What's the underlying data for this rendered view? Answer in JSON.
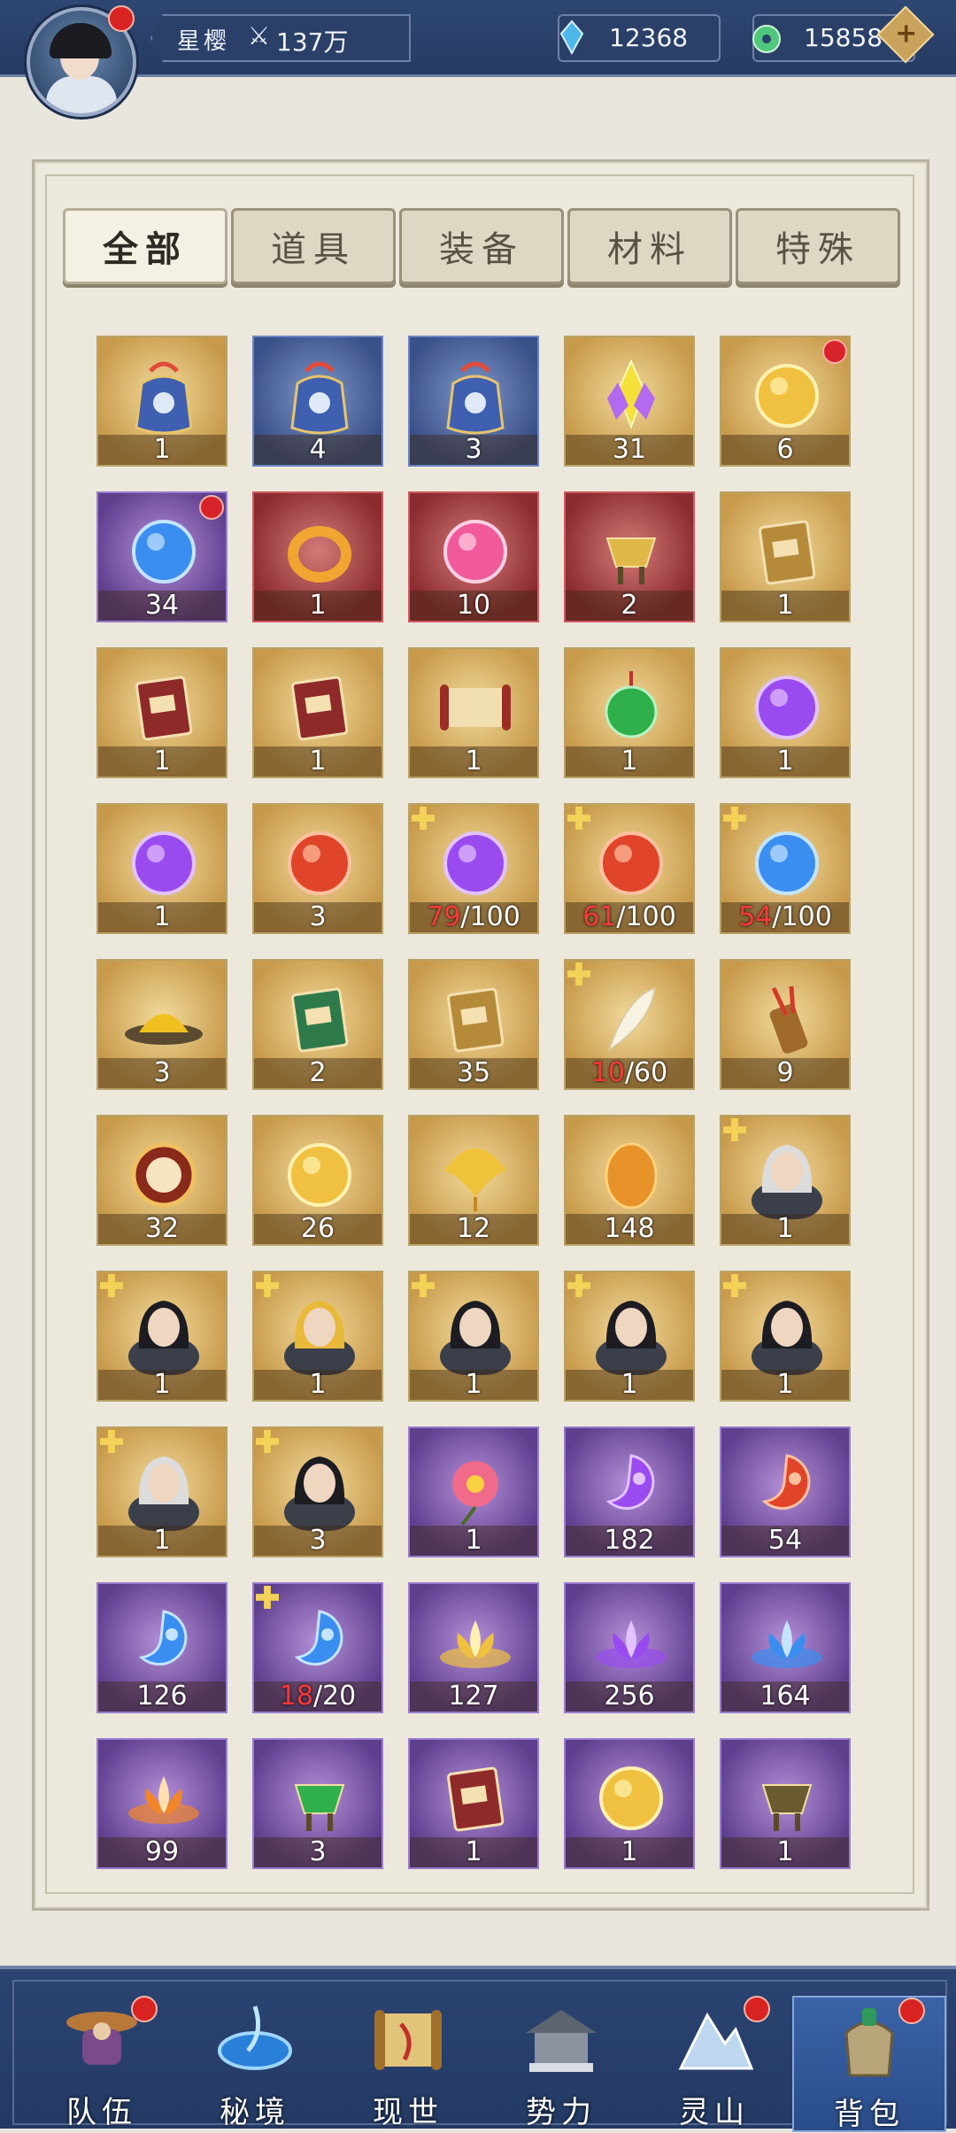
{
  "header": {
    "player_name": "星樱",
    "power": "137万",
    "currency_crystal": "12368",
    "currency_jade": "15858",
    "add_label": "+"
  },
  "tabs": [
    "全部",
    "道具",
    "装备",
    "材料",
    "特殊"
  ],
  "active_tab": "全部",
  "items": [
    {
      "name": "pouch-icon",
      "bg": "gold",
      "count": "1"
    },
    {
      "name": "pouch-icon",
      "bg": "blue",
      "count": "4"
    },
    {
      "name": "pouch-icon",
      "bg": "blue",
      "count": "3"
    },
    {
      "name": "crystal-flower-icon",
      "bg": "gold",
      "count": "31"
    },
    {
      "name": "koi-orb-icon",
      "bg": "gold",
      "count": "6",
      "dot": true
    },
    {
      "name": "blue-koi-orb-icon",
      "bg": "purple",
      "count": "34",
      "dot": true
    },
    {
      "name": "gold-ring-icon",
      "bg": "red",
      "count": "1"
    },
    {
      "name": "pink-orb-icon",
      "bg": "red",
      "count": "10"
    },
    {
      "name": "gold-bowl-icon",
      "bg": "red",
      "count": "2"
    },
    {
      "name": "gold-box-icon",
      "bg": "gold",
      "count": "1"
    },
    {
      "name": "red-book-icon",
      "bg": "gold",
      "count": "1"
    },
    {
      "name": "red-book-icon",
      "bg": "gold",
      "count": "1"
    },
    {
      "name": "scroll-icon",
      "bg": "gold",
      "count": "1"
    },
    {
      "name": "jade-pendant-icon",
      "bg": "gold",
      "count": "1"
    },
    {
      "name": "purple-vase-icon",
      "bg": "gold",
      "count": "1"
    },
    {
      "name": "purple-dragon-orb-icon",
      "bg": "gold",
      "count": "1"
    },
    {
      "name": "red-dragon-orb-icon",
      "bg": "gold",
      "count": "3"
    },
    {
      "name": "purple-dragon-orb-icon",
      "bg": "gold",
      "count": "/100",
      "cur": "79",
      "badge": true
    },
    {
      "name": "red-dragon-orb-icon",
      "bg": "gold",
      "count": "/100",
      "cur": "61",
      "badge": true
    },
    {
      "name": "blue-dragon-orb-icon",
      "bg": "gold",
      "count": "/100",
      "cur": "54",
      "badge": true
    },
    {
      "name": "yellow-powder-icon",
      "bg": "gold",
      "count": "3"
    },
    {
      "name": "green-book-icon",
      "bg": "gold",
      "count": "2"
    },
    {
      "name": "jade-book-icon",
      "bg": "gold",
      "count": "35"
    },
    {
      "name": "feather-icon",
      "bg": "gold",
      "count": "/60",
      "cur": "10",
      "badge": true
    },
    {
      "name": "arrow-quiver-icon",
      "bg": "gold",
      "count": "9"
    },
    {
      "name": "red-seal-icon",
      "bg": "gold",
      "count": "32"
    },
    {
      "name": "pearl-orb-icon",
      "bg": "gold",
      "count": "26"
    },
    {
      "name": "ginkgo-leaf-icon",
      "bg": "gold",
      "count": "12"
    },
    {
      "name": "amber-stone-icon",
      "bg": "gold",
      "count": "148"
    },
    {
      "name": "white-hair-portrait-icon",
      "bg": "gold",
      "count": "1",
      "badge": true
    },
    {
      "name": "black-hair-portrait-icon",
      "bg": "gold",
      "count": "1",
      "badge": true
    },
    {
      "name": "blonde-portrait-icon",
      "bg": "gold",
      "count": "1",
      "badge": true
    },
    {
      "name": "dark-warrior-portrait-icon",
      "bg": "gold",
      "count": "1",
      "badge": true
    },
    {
      "name": "lady-portrait-icon",
      "bg": "gold",
      "count": "1",
      "badge": true
    },
    {
      "name": "maiden-portrait-icon",
      "bg": "gold",
      "count": "1",
      "badge": true
    },
    {
      "name": "silver-hair-portrait-icon",
      "bg": "gold",
      "count": "1",
      "badge": true
    },
    {
      "name": "bearded-elder-portrait-icon",
      "bg": "gold",
      "count": "3",
      "badge": true
    },
    {
      "name": "pink-flower-icon",
      "bg": "purple",
      "count": "1"
    },
    {
      "name": "purple-magatama-icon",
      "bg": "purple",
      "count": "182"
    },
    {
      "name": "red-magatama-icon",
      "bg": "purple",
      "count": "54"
    },
    {
      "name": "blue-magatama-icon",
      "bg": "purple",
      "count": "126"
    },
    {
      "name": "blue-red-magatama-icon",
      "bg": "purple",
      "count": "/20",
      "cur": "18",
      "badge": true
    },
    {
      "name": "gold-lotus-icon",
      "bg": "purple",
      "count": "127"
    },
    {
      "name": "purple-lotus-icon",
      "bg": "purple",
      "count": "256"
    },
    {
      "name": "blue-lotus-icon",
      "bg": "purple",
      "count": "164"
    },
    {
      "name": "orange-lotus-icon",
      "bg": "purple",
      "count": "99"
    },
    {
      "name": "jade-cauldron-icon",
      "bg": "purple",
      "count": "3"
    },
    {
      "name": "red-tome-icon",
      "bg": "purple",
      "count": "1"
    },
    {
      "name": "storm-orb-icon",
      "bg": "purple",
      "count": "1"
    },
    {
      "name": "bronze-vessel-icon",
      "bg": "purple",
      "count": "1"
    }
  ],
  "nav": [
    {
      "label": "队伍",
      "icon": "team-icon",
      "dot": true
    },
    {
      "label": "秘境",
      "icon": "portal-icon",
      "dot": false
    },
    {
      "label": "现世",
      "icon": "world-map-icon",
      "dot": false
    },
    {
      "label": "势力",
      "icon": "faction-hall-icon",
      "dot": false
    },
    {
      "label": "灵山",
      "icon": "spirit-mountain-icon",
      "dot": true
    },
    {
      "label": "背包",
      "icon": "backpack-icon",
      "dot": true,
      "active": true
    }
  ],
  "colors": {
    "item_gold": "#c79a4b",
    "item_blue": "#3a5088",
    "item_purple": "#5e3f8e",
    "item_red": "#8a2b2f",
    "progress_red": "#ff3838"
  }
}
